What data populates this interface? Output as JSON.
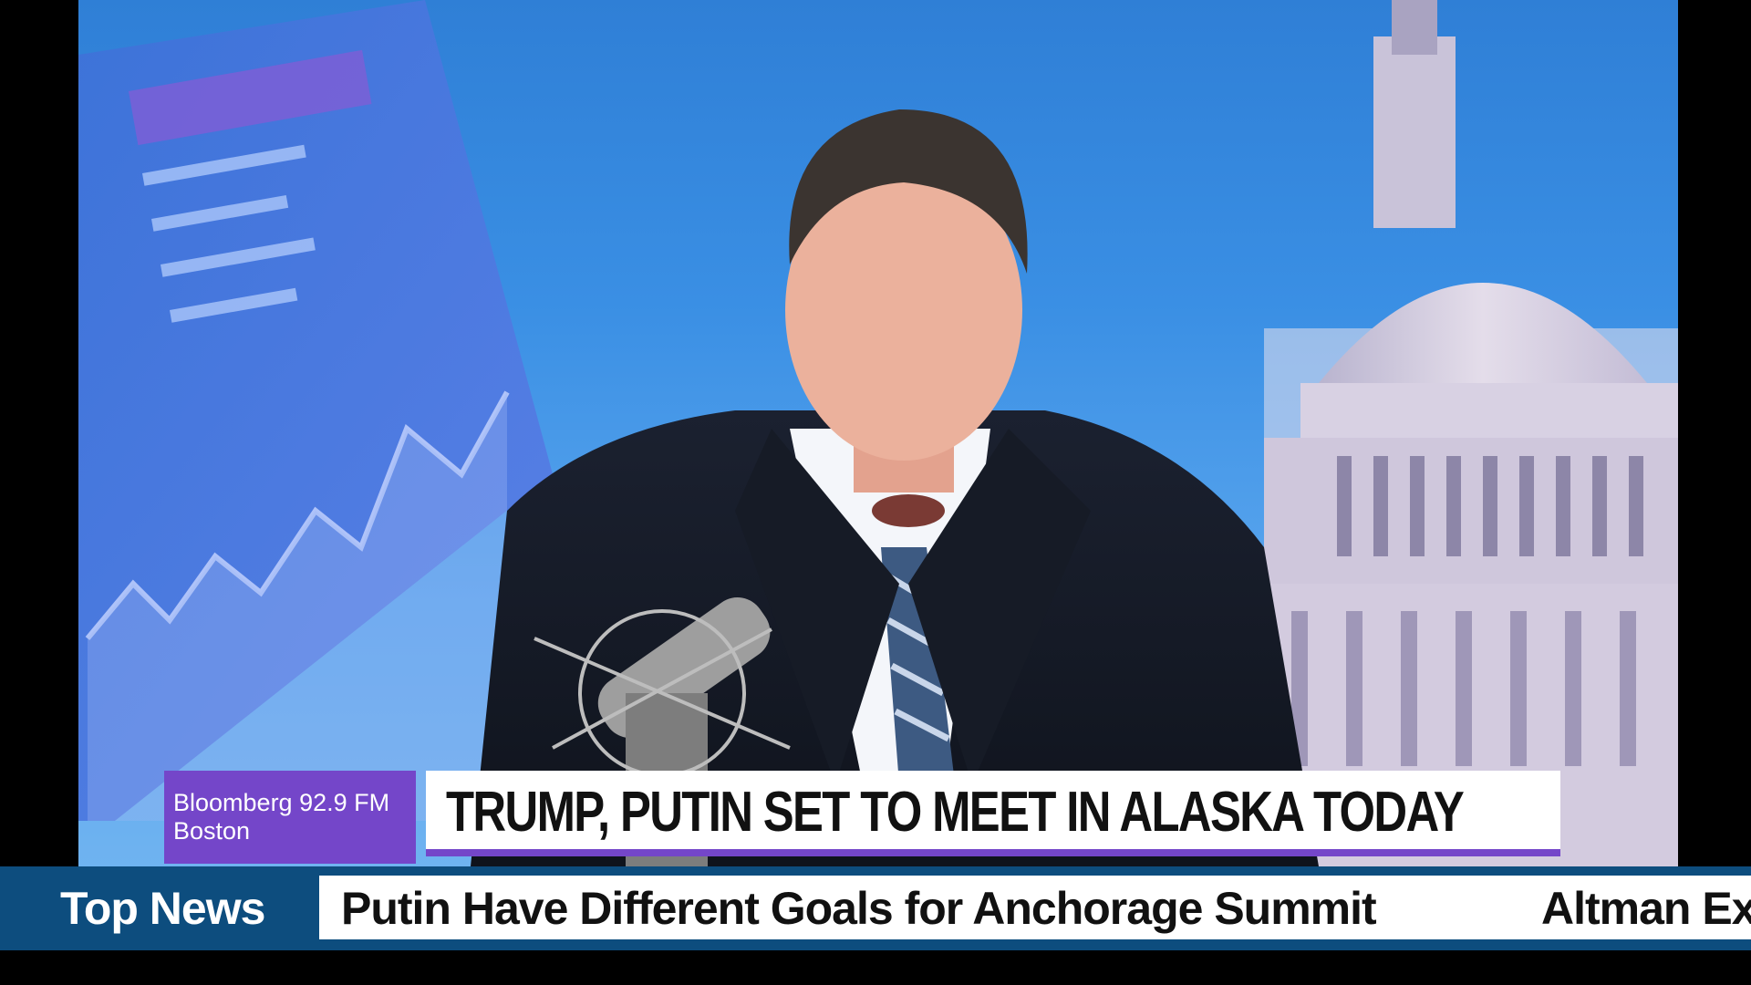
{
  "station": {
    "line1": "Bloomberg 92.9 FM",
    "line2": "Boston"
  },
  "headline": {
    "text": "TRUMP, PUTIN SET TO MEET IN ALASKA TODAY"
  },
  "ticker": {
    "label": "Top News",
    "items": [
      "Putin Have  Different Goals for Anchorage  Summit",
      "Altman Ex"
    ]
  },
  "colors": {
    "accent_purple": "#7446c9",
    "ticker_blue": "#0d4d7e",
    "studio_blue": "#3a8fe4"
  }
}
